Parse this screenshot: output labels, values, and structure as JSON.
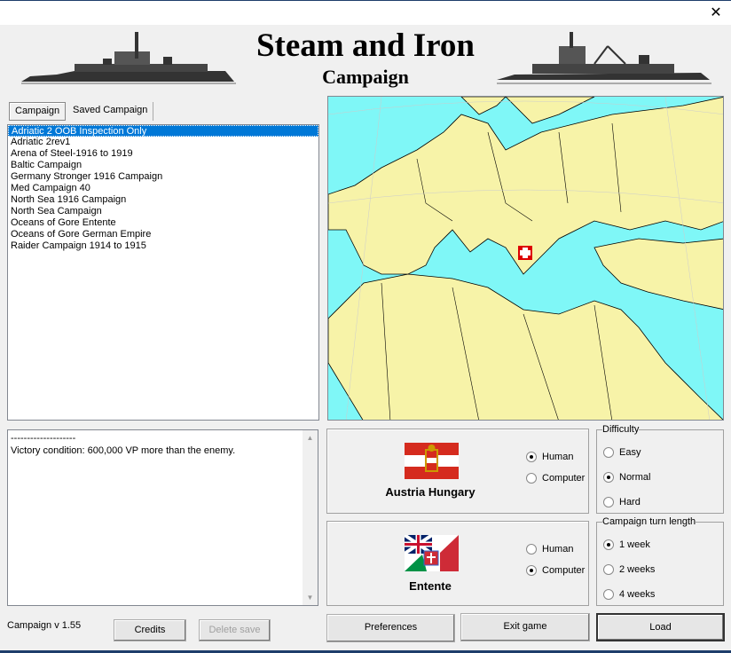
{
  "window": {
    "close_icon": "close-icon"
  },
  "header": {
    "title": "Steam and Iron",
    "subtitle": "Campaign"
  },
  "tabs": [
    "Campaign",
    "Saved Campaign"
  ],
  "campaigns": [
    "Adriatic 2 OOB Inspection Only",
    "Adriatic 2rev1",
    "Arena of Steel-1916 to 1919",
    "Baltic Campaign",
    "Germany Stronger 1916 Campaign",
    "Med Campaign 40",
    "North Sea 1916 Campaign",
    "North Sea Campaign",
    "Oceans of Gore Entente",
    "Oceans of Gore German Empire",
    "Raider Campaign 1914 to 1915"
  ],
  "selected_campaign": 0,
  "description": {
    "line1": "--------------------",
    "line2": "Victory condition: 600,000 VP more than the enemy."
  },
  "version": "Campaign v 1.55",
  "buttons": {
    "credits": "Credits",
    "delete_save": "Delete save",
    "preferences": "Preferences",
    "exit": "Exit game",
    "load": "Load"
  },
  "sides": [
    {
      "name": "Austria Hungary",
      "human": "Human",
      "computer": "Computer",
      "selected": "Human"
    },
    {
      "name": "Entente",
      "human": "Human",
      "computer": "Computer",
      "selected": "Computer"
    }
  ],
  "difficulty": {
    "label": "Difficulty",
    "options": [
      "Easy",
      "Normal",
      "Hard"
    ],
    "selected": "Normal"
  },
  "turn_length": {
    "label": "Campaign turn length",
    "options": [
      "1 week",
      "2 weeks",
      "4 weeks"
    ],
    "selected": "1 week"
  },
  "colors": {
    "sea": "#7ff7f7",
    "land": "#f7f3a8",
    "selection": "#0078d7"
  }
}
